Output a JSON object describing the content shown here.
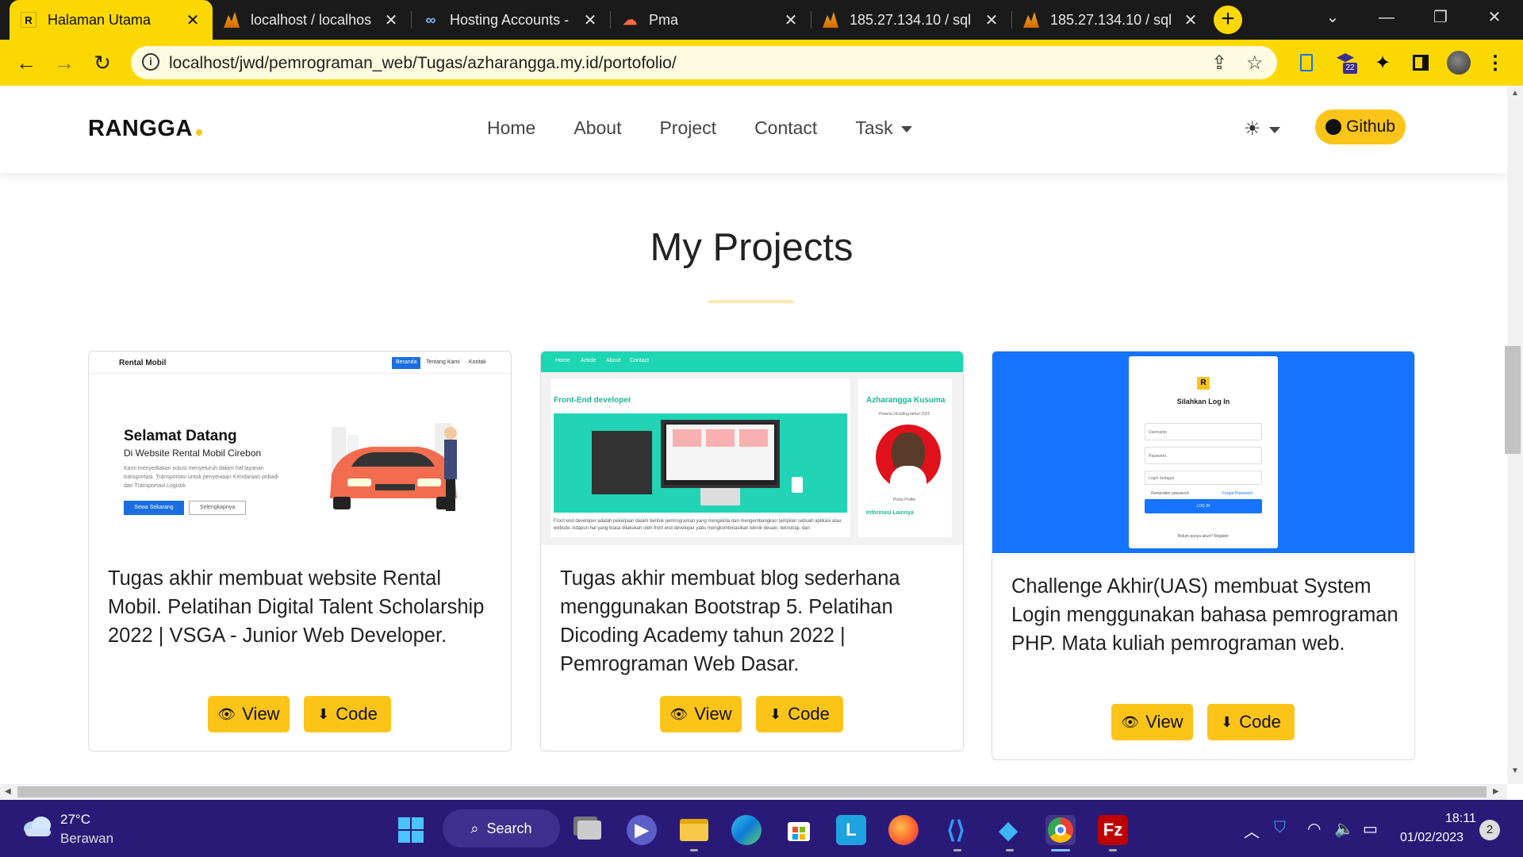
{
  "browser": {
    "tabs": [
      {
        "title": "Halaman Utama",
        "favicon": "R"
      },
      {
        "title": "localhost / localhos",
        "favicon": "pma-icon"
      },
      {
        "title": "Hosting Accounts -",
        "favicon": "infinity-icon"
      },
      {
        "title": "Pma",
        "favicon": "pma-cloud-icon"
      },
      {
        "title": "185.27.134.10 / sql",
        "favicon": "pma-icon"
      },
      {
        "title": "185.27.134.10 / sql",
        "favicon": "pma-icon"
      }
    ],
    "url": "localhost/jwd/pemrograman_web/Tugas/azharangga.my.id/portofolio/",
    "extension_badge": "22",
    "accent_color": "#fcd803"
  },
  "site": {
    "brand": "RANGGA",
    "nav": [
      "Home",
      "About",
      "Project",
      "Contact",
      "Task"
    ],
    "github_label": "Github",
    "section_title": "My Projects",
    "accent_color": "#fcc419"
  },
  "projects": [
    {
      "description": "Tugas akhir membuat website Rental Mobil. Pelatihan Digital Talent Scholarship 2022 | VSGA - Junior Web Developer.",
      "view_label": "View",
      "code_label": "Code",
      "thumb": {
        "brand": "Rental Mobil",
        "nav": [
          "Beranda",
          "Tentang Kami",
          "Kontak"
        ],
        "heading": "Selamat Datang",
        "sub": "Di Website Rental Mobil Cirebon",
        "para": "Kami menyediakan solusi menyeluruh dalam hal layanan transportasi. Transportasi untuk penyewaan Kendaraan pribadi dan Transportasi Logistik",
        "btn1": "Sewa Sekarang",
        "btn2": "Selengkapnya"
      }
    },
    {
      "description": "Tugas akhir membuat blog sederhana menggunakan Bootstrap 5. Pelatihan Dicoding Academy tahun 2022 | Pemrograman Web Dasar.",
      "view_label": "View",
      "code_label": "Code",
      "thumb": {
        "nav": [
          "Home",
          "Article",
          "About",
          "Contact"
        ],
        "heading": "Front-End developer",
        "name": "Azharangga Kusuma",
        "subtitle": "Peserta Dicoding tahun 2022",
        "photo_caption": "Photo Profile",
        "info_heading": "Informasi Lainnya",
        "para": "Front end developer adalah pekerjaan dalam bentuk pemrograman yang mengelola dan mengembangkan tampilan sebuah aplikasi atau website. Adapun hal yang biasa dilakukan oleh front end developer yaitu mengkombinasikan teknik desain, teknologi, dan"
      }
    },
    {
      "description": "Challenge Akhir(UAS) membuat System Login menggunakan bahasa pemrograman PHP. Mata kuliah pemrograman web.",
      "view_label": "View",
      "code_label": "Code",
      "thumb": {
        "logo": "R",
        "title": "Silahkan Log In",
        "username": "Username",
        "password": "Password",
        "role": "Login Sebagai",
        "remember": "Remember password",
        "forgot": "Forgot Password",
        "login_btn": "LOG IN",
        "register": "Belum punya akun? Register"
      }
    }
  ],
  "taskbar": {
    "temperature": "27°C",
    "weather": "Berawan",
    "search_label": "Search",
    "time": "18:11",
    "date": "01/02/2023",
    "notifications": "2"
  }
}
